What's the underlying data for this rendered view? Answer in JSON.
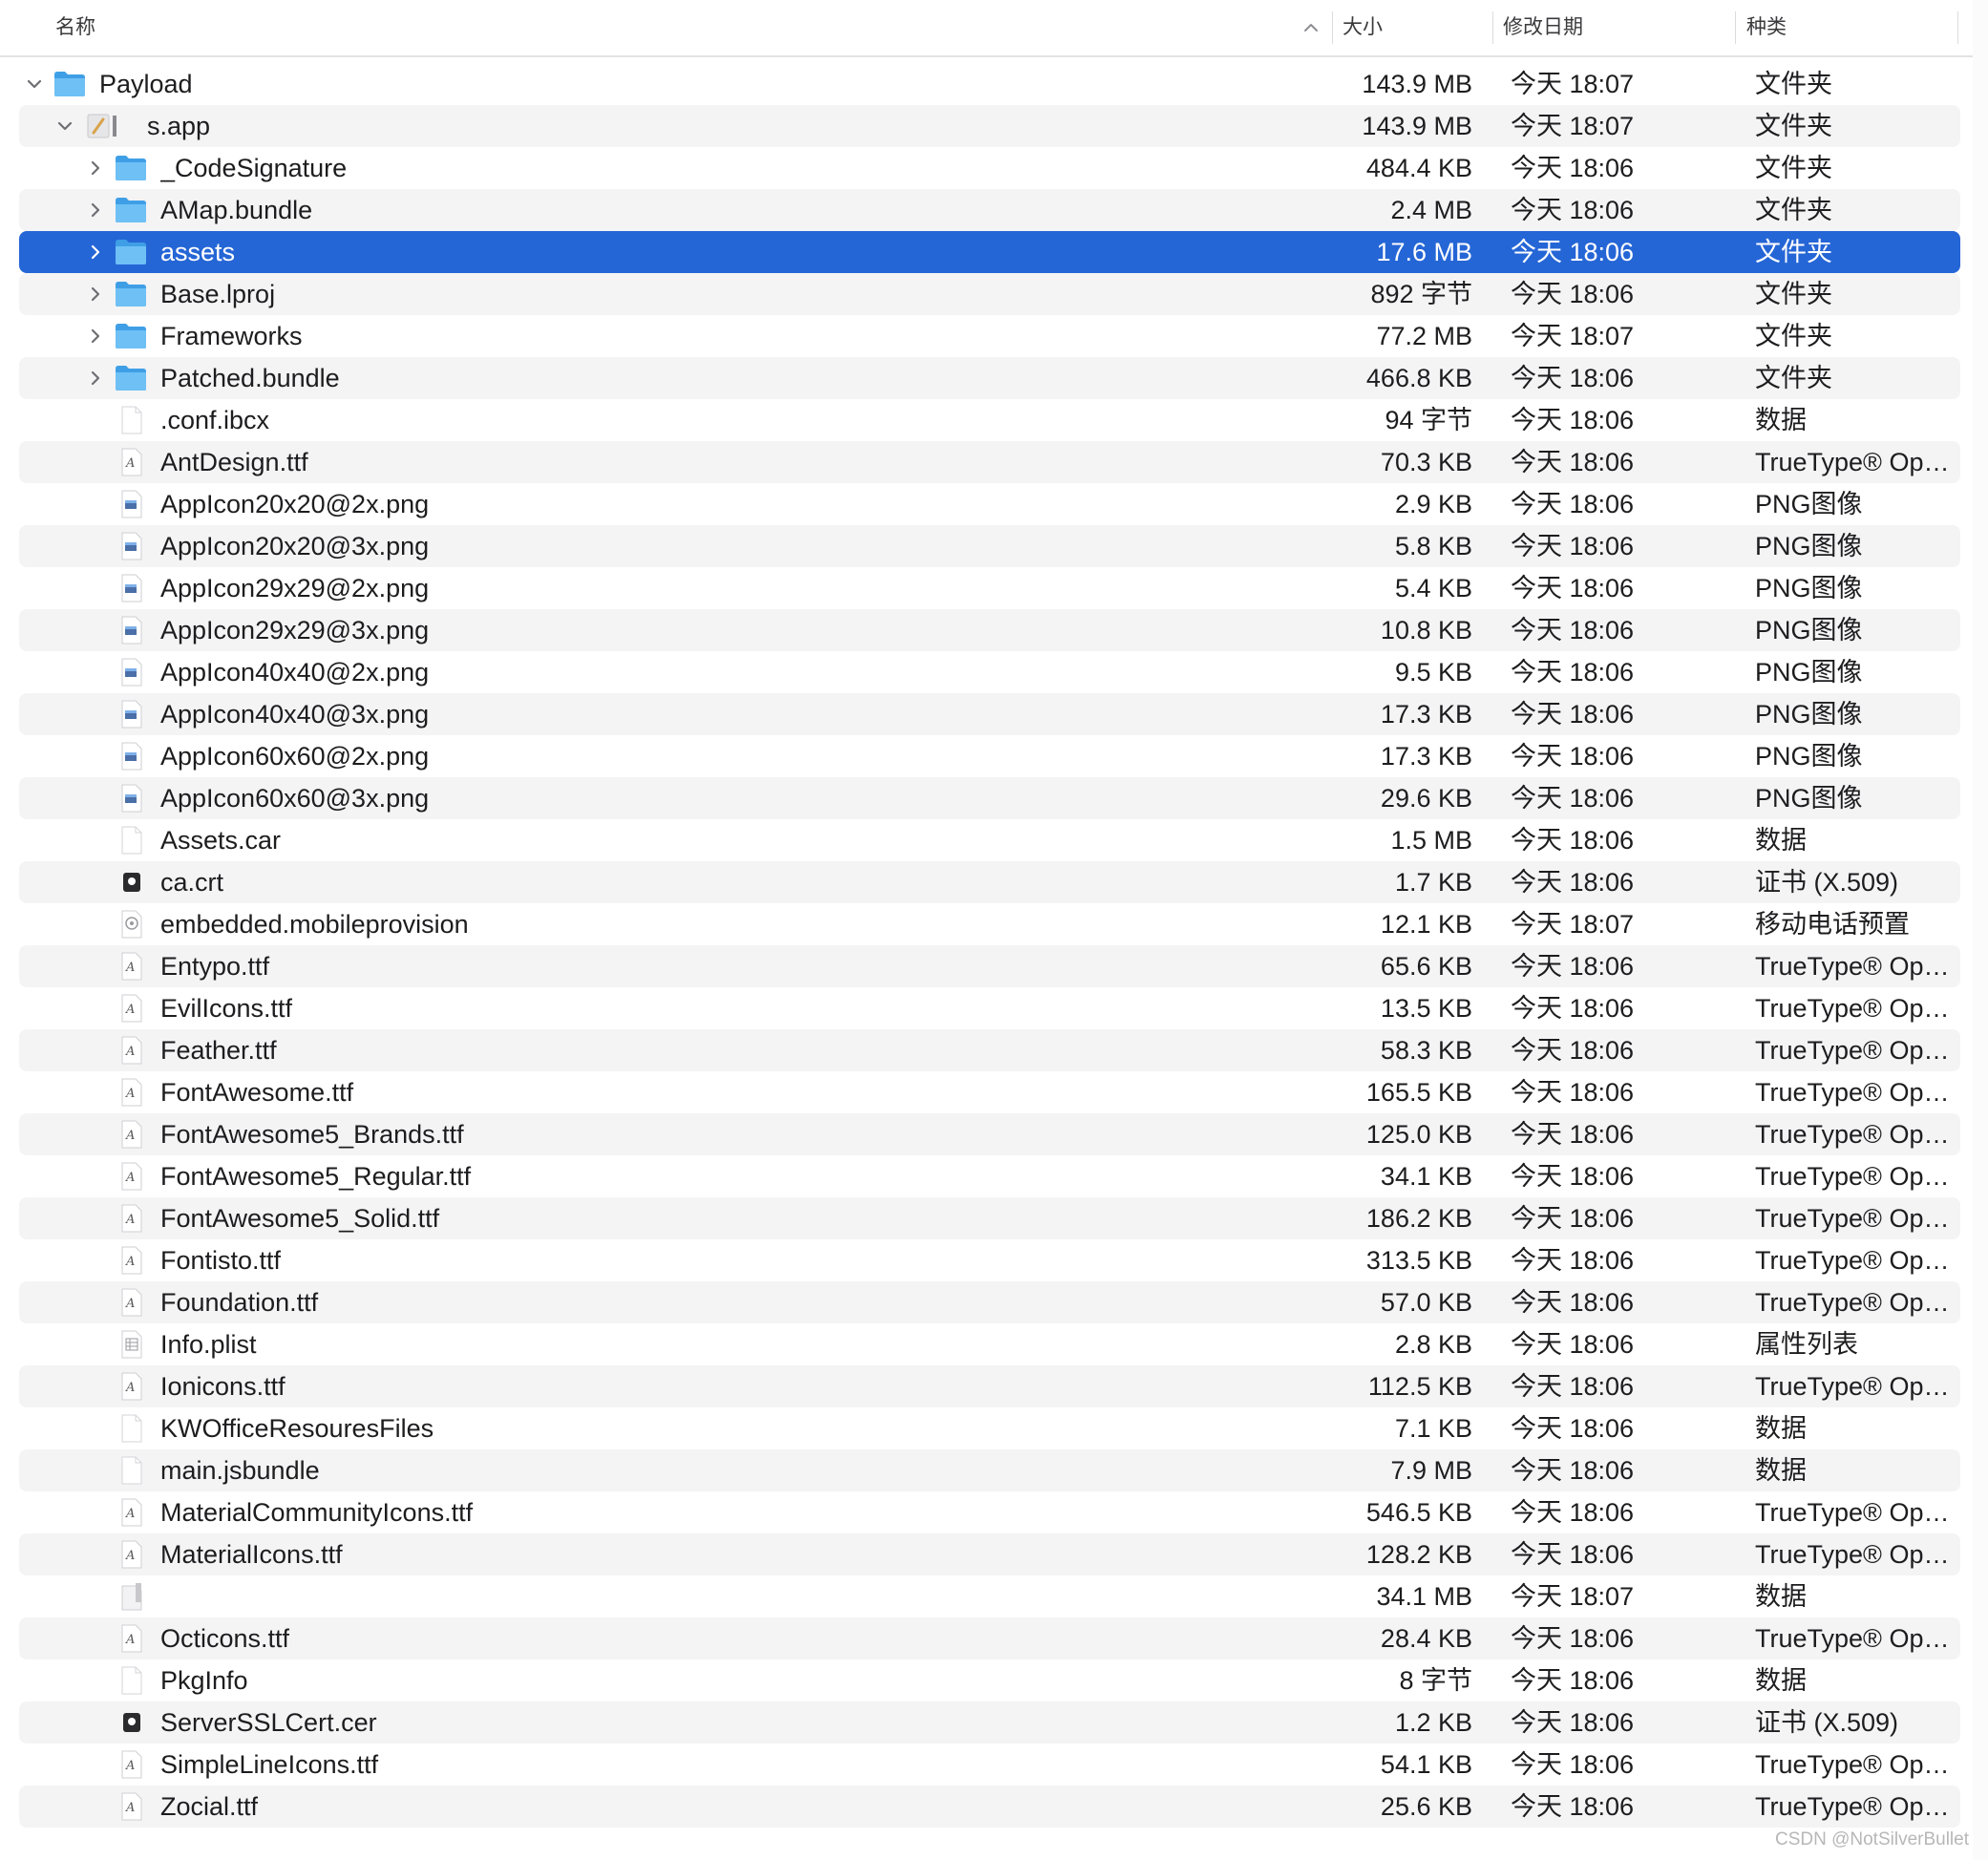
{
  "header": {
    "name": "名称",
    "size": "大小",
    "date": "修改日期",
    "kind": "种类"
  },
  "rows": [
    {
      "name": "Payload",
      "size": "143.9 MB",
      "date": "今天 18:07",
      "kind": "文件夹",
      "level": 0,
      "icon": "folder-icon",
      "disclosure": "expanded"
    },
    {
      "name": "s.app",
      "size": "143.9 MB",
      "date": "今天 18:07",
      "kind": "文件夹",
      "level": 1,
      "icon": "app-icon",
      "disclosure": "expanded"
    },
    {
      "name": "_CodeSignature",
      "size": "484.4 KB",
      "date": "今天 18:06",
      "kind": "文件夹",
      "level": 2,
      "icon": "folder-icon",
      "disclosure": "collapsed"
    },
    {
      "name": "AMap.bundle",
      "size": "2.4 MB",
      "date": "今天 18:06",
      "kind": "文件夹",
      "level": 2,
      "icon": "folder-icon",
      "disclosure": "collapsed"
    },
    {
      "name": "assets",
      "size": "17.6 MB",
      "date": "今天 18:06",
      "kind": "文件夹",
      "level": 2,
      "icon": "folder-icon",
      "disclosure": "collapsed",
      "selected": true
    },
    {
      "name": "Base.lproj",
      "size": "892 字节",
      "date": "今天 18:06",
      "kind": "文件夹",
      "level": 2,
      "icon": "folder-icon",
      "disclosure": "collapsed"
    },
    {
      "name": "Frameworks",
      "size": "77.2 MB",
      "date": "今天 18:07",
      "kind": "文件夹",
      "level": 2,
      "icon": "folder-icon",
      "disclosure": "collapsed"
    },
    {
      "name": "Patched.bundle",
      "size": "466.8 KB",
      "date": "今天 18:06",
      "kind": "文件夹",
      "level": 2,
      "icon": "folder-icon",
      "disclosure": "collapsed"
    },
    {
      "name": ".conf.ibcx",
      "size": "94 字节",
      "date": "今天 18:06",
      "kind": "数据",
      "level": 2,
      "icon": "blank-document-icon",
      "disclosure": "none"
    },
    {
      "name": "AntDesign.ttf",
      "size": "70.3 KB",
      "date": "今天 18:06",
      "kind": "TrueType® OpenType font",
      "level": 2,
      "icon": "font-file-icon",
      "disclosure": "none"
    },
    {
      "name": "AppIcon20x20@2x.png",
      "size": "2.9 KB",
      "date": "今天 18:06",
      "kind": "PNG图像",
      "level": 2,
      "icon": "image-file-icon",
      "disclosure": "none"
    },
    {
      "name": "AppIcon20x20@3x.png",
      "size": "5.8 KB",
      "date": "今天 18:06",
      "kind": "PNG图像",
      "level": 2,
      "icon": "image-file-icon",
      "disclosure": "none"
    },
    {
      "name": "AppIcon29x29@2x.png",
      "size": "5.4 KB",
      "date": "今天 18:06",
      "kind": "PNG图像",
      "level": 2,
      "icon": "image-file-icon",
      "disclosure": "none"
    },
    {
      "name": "AppIcon29x29@3x.png",
      "size": "10.8 KB",
      "date": "今天 18:06",
      "kind": "PNG图像",
      "level": 2,
      "icon": "image-file-icon",
      "disclosure": "none"
    },
    {
      "name": "AppIcon40x40@2x.png",
      "size": "9.5 KB",
      "date": "今天 18:06",
      "kind": "PNG图像",
      "level": 2,
      "icon": "image-file-icon",
      "disclosure": "none"
    },
    {
      "name": "AppIcon40x40@3x.png",
      "size": "17.3 KB",
      "date": "今天 18:06",
      "kind": "PNG图像",
      "level": 2,
      "icon": "image-file-icon",
      "disclosure": "none"
    },
    {
      "name": "AppIcon60x60@2x.png",
      "size": "17.3 KB",
      "date": "今天 18:06",
      "kind": "PNG图像",
      "level": 2,
      "icon": "image-file-icon",
      "disclosure": "none"
    },
    {
      "name": "AppIcon60x60@3x.png",
      "size": "29.6 KB",
      "date": "今天 18:06",
      "kind": "PNG图像",
      "level": 2,
      "icon": "image-file-icon",
      "disclosure": "none"
    },
    {
      "name": "Assets.car",
      "size": "1.5 MB",
      "date": "今天 18:06",
      "kind": "数据",
      "level": 2,
      "icon": "blank-document-icon",
      "disclosure": "none"
    },
    {
      "name": "ca.crt",
      "size": "1.7 KB",
      "date": "今天 18:06",
      "kind": "证书 (X.509)",
      "level": 2,
      "icon": "certificate-icon",
      "disclosure": "none"
    },
    {
      "name": "embedded.mobileprovision",
      "size": "12.1 KB",
      "date": "今天 18:07",
      "kind": "移动电话预置",
      "level": 2,
      "icon": "provision-file-icon",
      "disclosure": "none"
    },
    {
      "name": "Entypo.ttf",
      "size": "65.6 KB",
      "date": "今天 18:06",
      "kind": "TrueType® OpenType font",
      "level": 2,
      "icon": "font-file-icon",
      "disclosure": "none"
    },
    {
      "name": "EvilIcons.ttf",
      "size": "13.5 KB",
      "date": "今天 18:06",
      "kind": "TrueType® OpenType font",
      "level": 2,
      "icon": "font-file-icon",
      "disclosure": "none"
    },
    {
      "name": "Feather.ttf",
      "size": "58.3 KB",
      "date": "今天 18:06",
      "kind": "TrueType® OpenType font",
      "level": 2,
      "icon": "font-file-icon",
      "disclosure": "none"
    },
    {
      "name": "FontAwesome.ttf",
      "size": "165.5 KB",
      "date": "今天 18:06",
      "kind": "TrueType® OpenType font",
      "level": 2,
      "icon": "font-file-icon",
      "disclosure": "none"
    },
    {
      "name": "FontAwesome5_Brands.ttf",
      "size": "125.0 KB",
      "date": "今天 18:06",
      "kind": "TrueType® OpenType font",
      "level": 2,
      "icon": "font-file-icon",
      "disclosure": "none"
    },
    {
      "name": "FontAwesome5_Regular.ttf",
      "size": "34.1 KB",
      "date": "今天 18:06",
      "kind": "TrueType® OpenType font",
      "level": 2,
      "icon": "font-file-icon",
      "disclosure": "none"
    },
    {
      "name": "FontAwesome5_Solid.ttf",
      "size": "186.2 KB",
      "date": "今天 18:06",
      "kind": "TrueType® OpenType font",
      "level": 2,
      "icon": "font-file-icon",
      "disclosure": "none"
    },
    {
      "name": "Fontisto.ttf",
      "size": "313.5 KB",
      "date": "今天 18:06",
      "kind": "TrueType® OpenType font",
      "level": 2,
      "icon": "font-file-icon",
      "disclosure": "none"
    },
    {
      "name": "Foundation.ttf",
      "size": "57.0 KB",
      "date": "今天 18:06",
      "kind": "TrueType® OpenType font",
      "level": 2,
      "icon": "font-file-icon",
      "disclosure": "none"
    },
    {
      "name": "Info.plist",
      "size": "2.8 KB",
      "date": "今天 18:06",
      "kind": "属性列表",
      "level": 2,
      "icon": "plist-file-icon",
      "disclosure": "none"
    },
    {
      "name": "Ionicons.ttf",
      "size": "112.5 KB",
      "date": "今天 18:06",
      "kind": "TrueType® OpenType font",
      "level": 2,
      "icon": "font-file-icon",
      "disclosure": "none"
    },
    {
      "name": "KWOfficeResouresFiles",
      "size": "7.1 KB",
      "date": "今天 18:06",
      "kind": "数据",
      "level": 2,
      "icon": "blank-document-icon",
      "disclosure": "none"
    },
    {
      "name": "main.jsbundle",
      "size": "7.9 MB",
      "date": "今天 18:06",
      "kind": "数据",
      "level": 2,
      "icon": "blank-document-icon",
      "disclosure": "none"
    },
    {
      "name": "MaterialCommunityIcons.ttf",
      "size": "546.5 KB",
      "date": "今天 18:06",
      "kind": "TrueType® OpenType font",
      "level": 2,
      "icon": "font-file-icon",
      "disclosure": "none"
    },
    {
      "name": "MaterialIcons.ttf",
      "size": "128.2 KB",
      "date": "今天 18:06",
      "kind": "TrueType® OpenType font",
      "level": 2,
      "icon": "font-file-icon",
      "disclosure": "none"
    },
    {
      "name": "",
      "size": "34.1 MB",
      "date": "今天 18:07",
      "kind": "数据",
      "level": 2,
      "icon": "executable-file-icon",
      "disclosure": "none"
    },
    {
      "name": "Octicons.ttf",
      "size": "28.4 KB",
      "date": "今天 18:06",
      "kind": "TrueType® OpenType font",
      "level": 2,
      "icon": "font-file-icon",
      "disclosure": "none"
    },
    {
      "name": "PkgInfo",
      "size": "8 字节",
      "date": "今天 18:06",
      "kind": "数据",
      "level": 2,
      "icon": "blank-document-icon",
      "disclosure": "none"
    },
    {
      "name": "ServerSSLCert.cer",
      "size": "1.2 KB",
      "date": "今天 18:06",
      "kind": "证书 (X.509)",
      "level": 2,
      "icon": "certificate-icon",
      "disclosure": "none"
    },
    {
      "name": "SimpleLineIcons.ttf",
      "size": "54.1 KB",
      "date": "今天 18:06",
      "kind": "TrueType® OpenType font",
      "level": 2,
      "icon": "font-file-icon",
      "disclosure": "none"
    },
    {
      "name": "Zocial.ttf",
      "size": "25.6 KB",
      "date": "今天 18:06",
      "kind": "TrueType® OpenType font",
      "level": 2,
      "icon": "font-file-icon",
      "disclosure": "none"
    }
  ],
  "watermark": "CSDN @NotSilverBullet",
  "colors": {
    "selection": "#2566d6",
    "stripe": "#f4f4f5",
    "folder": "#5cb5f0",
    "text": "#1d1d1f"
  }
}
